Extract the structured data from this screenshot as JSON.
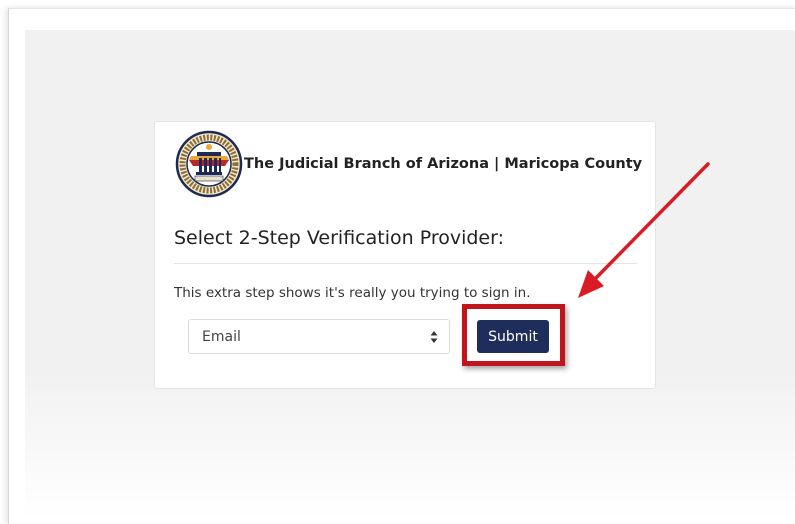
{
  "header": {
    "org_name": "The Judicial Branch of Arizona | Maricopa County"
  },
  "main": {
    "title": "Select 2-Step Verification Provider:",
    "subtitle": "This extra step shows it's really you trying to sign in.",
    "provider_select": {
      "selected": "Email"
    },
    "submit_label": "Submit"
  },
  "colors": {
    "submit_button": "#1f2d5c",
    "annotation": "#c0151d"
  },
  "icons": {
    "logo": "arizona-judicial-seal",
    "select_caret": "up-down-caret-icon",
    "annotation_arrow": "red-arrow"
  }
}
